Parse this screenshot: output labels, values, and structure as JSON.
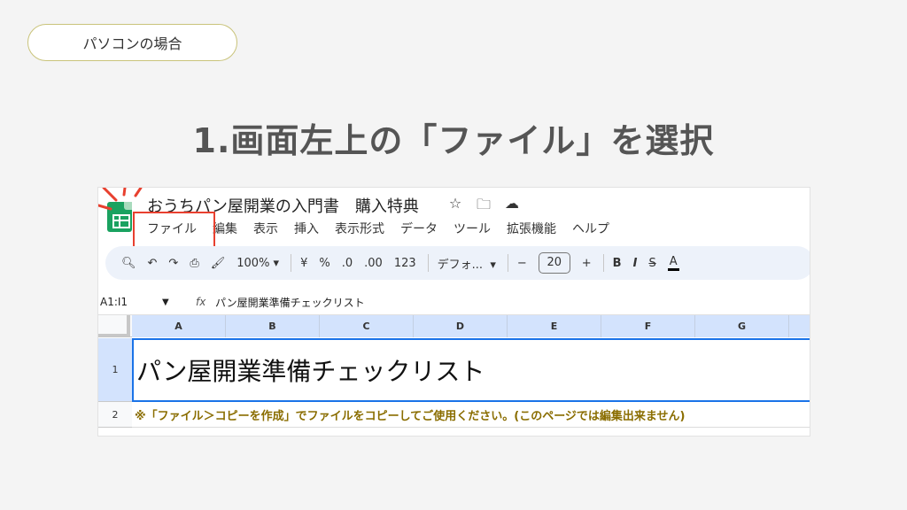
{
  "badge": {
    "label": "パソコンの場合"
  },
  "instruction": {
    "title": "1.画面左上の「ファイル」を選択"
  },
  "app": {
    "doc_title": "おうちパン屋開業の入門書　購入特典",
    "title_icons": [
      "star-icon",
      "move-folder-icon",
      "cloud-saved-icon"
    ],
    "menu": [
      "ファイル",
      "編集",
      "表示",
      "挿入",
      "表示形式",
      "データ",
      "ツール",
      "拡張機能",
      "ヘルプ"
    ],
    "toolbar": {
      "zoom": "100%",
      "currency": "¥",
      "percent": "%",
      "decrease_decimal": ".0",
      "increase_decimal": ".00",
      "number_format": "123",
      "font": "デフォ...",
      "font_size": "20",
      "minus": "−",
      "plus": "+",
      "bold": "B",
      "italic": "I",
      "strike": "S",
      "text_color": "A"
    },
    "formula_bar": {
      "cell_ref": "A1:I1",
      "fx": "fx",
      "value": "パン屋開業準備チェックリスト"
    },
    "columns": [
      "A",
      "B",
      "C",
      "D",
      "E",
      "F",
      "G"
    ],
    "rows": [
      {
        "num": "1",
        "text": "パン屋開業準備チェックリスト"
      },
      {
        "num": "2",
        "text": "※「ファイル＞コピーを作成」でファイルをコピーしてご使用ください。(このページでは編集出来ません)"
      }
    ]
  },
  "colors": {
    "highlight_box": "#e8402f",
    "note_text": "#8a6d00",
    "selection": "#1a73e8"
  }
}
